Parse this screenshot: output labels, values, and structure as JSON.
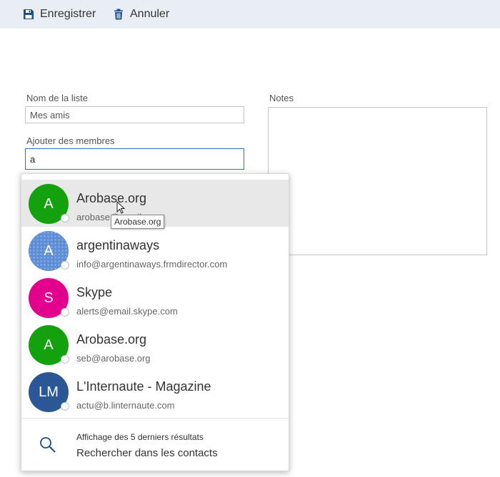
{
  "toolbar": {
    "save_label": "Enregistrer",
    "cancel_label": "Annuler",
    "save_icon": "floppy-disk-icon",
    "cancel_icon": "trash-icon",
    "icon_color": "#1f4e8c"
  },
  "form": {
    "list_name_label": "Nom de la liste",
    "list_name_value": "Mes amis",
    "add_members_label": "Ajouter des membres",
    "add_members_value": "a",
    "notes_label": "Notes"
  },
  "results": [
    {
      "initials": "A",
      "name": "Arobase.org",
      "email": "arobase@gmail.com",
      "avatar_color": "#13a10e",
      "hovered": true
    },
    {
      "initials": "A",
      "name": "argentinaways",
      "email": "info@argentinaways.frmdirector.com",
      "avatar_color": "#5d8ed6",
      "hovered": false
    },
    {
      "initials": "S",
      "name": "Skype",
      "email": "alerts@email.skype.com",
      "avatar_color": "#e3008c",
      "hovered": false
    },
    {
      "initials": "A",
      "name": "Arobase.org",
      "email": "seb@arobase.org",
      "avatar_color": "#13a10e",
      "hovered": false
    },
    {
      "initials": "LM",
      "name": "L'Internaute - Magazine",
      "email": "actu@b.linternaute.com",
      "avatar_color": "#2b5797",
      "hovered": false
    }
  ],
  "footer": {
    "info_text": "Affichage des 5 derniers résultats",
    "search_label": "Rechercher dans les contacts",
    "search_icon": "search-icon"
  },
  "tooltip": {
    "text": "Arobase.org"
  }
}
